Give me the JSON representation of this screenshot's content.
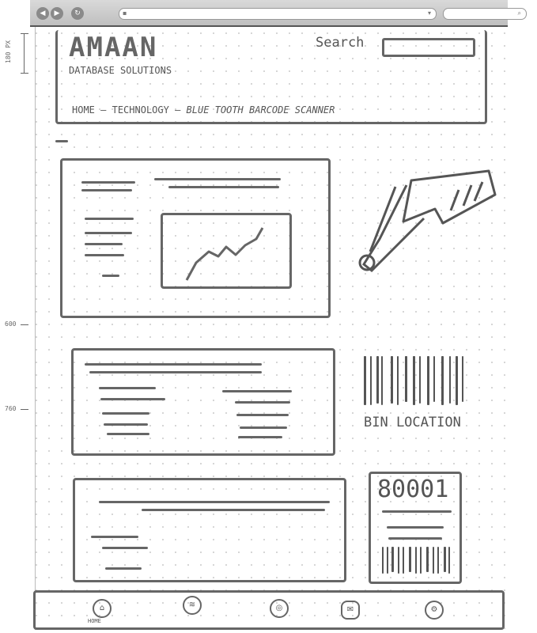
{
  "header": {
    "logo_text": "AMAAN",
    "logo_subtitle": "DATABASE SOLUTIONS",
    "search_label": "Search",
    "breadcrumb": [
      "HOME",
      "TECHNOLOGY",
      "BLUE TOOTH BARCODE SCANNER"
    ]
  },
  "ruler": {
    "mark_top": "180 PX",
    "mark_600": "600",
    "mark_760": "760"
  },
  "bin_location_label": "BIN LOCATION",
  "label_card_number": "80001",
  "bottom_nav": {
    "home_label": "HOME"
  }
}
